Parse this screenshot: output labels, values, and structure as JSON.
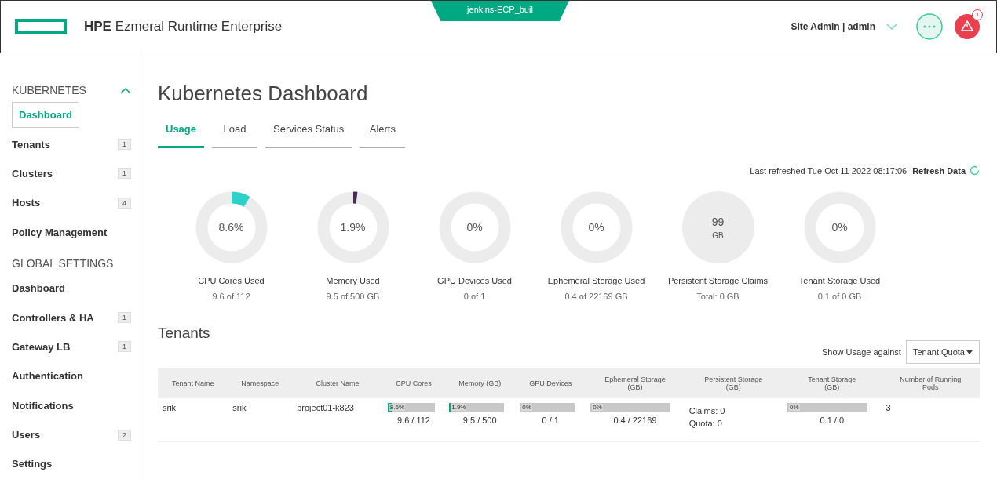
{
  "header": {
    "brand_bold": "HPE",
    "brand": "Ezmeral Runtime Enterprise",
    "context_tab": "jenkins-ECP_buil",
    "user": "Site Admin | admin",
    "alert_badge": "1"
  },
  "sidebar": {
    "items": [
      {
        "kind": "section",
        "label": "KUBERNETES",
        "expanded": true
      },
      {
        "kind": "item",
        "label": "Dashboard",
        "selected": true
      },
      {
        "kind": "item",
        "label": "Tenants",
        "count": "1",
        "selected": false
      },
      {
        "kind": "item",
        "label": "Clusters",
        "count": "1",
        "selected": false
      },
      {
        "kind": "item",
        "label": "Hosts",
        "count": "4",
        "selected": false
      },
      {
        "kind": "item",
        "label": "Policy Management",
        "selected": false
      },
      {
        "kind": "section",
        "label": "GLOBAL SETTINGS"
      },
      {
        "kind": "item",
        "label": "Dashboard",
        "selected": false
      },
      {
        "kind": "item",
        "label": "Controllers & HA",
        "count": "1",
        "selected": false
      },
      {
        "kind": "item",
        "label": "Gateway LB",
        "count": "1",
        "selected": false
      },
      {
        "kind": "item",
        "label": "Authentication",
        "selected": false
      },
      {
        "kind": "item",
        "label": "Notifications",
        "selected": false
      },
      {
        "kind": "item",
        "label": "Users",
        "count": "2",
        "selected": false
      },
      {
        "kind": "item",
        "label": "Settings",
        "selected": false
      }
    ]
  },
  "page": {
    "title": "Kubernetes Dashboard",
    "tabs": [
      {
        "label": "Usage",
        "selected": true
      },
      {
        "label": "Load",
        "selected": false
      },
      {
        "label": "Services Status",
        "selected": false
      },
      {
        "label": "Alerts",
        "selected": false
      }
    ],
    "last_refreshed": "Last refreshed Tue Oct 11 2022 08:17:06",
    "refresh_button": "Refresh Data",
    "gauges": [
      {
        "kind": "donut",
        "value": "8.6%",
        "level": 0.086,
        "color": "#2ad2c9",
        "label": "CPU Cores Used",
        "detail": "9.6 of 112"
      },
      {
        "kind": "donut",
        "value": "1.9%",
        "level": 0.019,
        "color": "#4b2a5a",
        "label": "Memory Used",
        "detail": "9.5 of 500 GB"
      },
      {
        "kind": "donut",
        "value": "0%",
        "label": "GPU Devices Used",
        "detail": "0 of 1"
      },
      {
        "kind": "donut",
        "value": "0%",
        "label": "Ephemeral Storage Used",
        "detail": "0.4 of 22169 GB"
      },
      {
        "kind": "filled",
        "value": "99",
        "unit": "GB",
        "label": "Persistent Storage Claims",
        "detail": "Total: 0 GB"
      },
      {
        "kind": "donut",
        "value": "0%",
        "label": "Tenant Storage Used",
        "detail": "0.1 of 0 GB"
      }
    ],
    "tenants": {
      "title": "Tenants",
      "usage_label": "Show Usage against",
      "usage_select": "Tenant Quota",
      "columns": [
        "Tenant Name",
        "Namespace",
        "Cluster Name",
        "CPU Cores",
        "Memory (GB)",
        "GPU Devices",
        "Ephemeral Storage (GB)",
        "Persistent Storage (GB)",
        "Tenant Storage (GB)",
        "Number of Running Pods"
      ],
      "rows": [
        {
          "cells": [
            {
              "kind": "text",
              "text": "srik"
            },
            {
              "kind": "text",
              "text": "srik"
            },
            {
              "kind": "text",
              "text": "project01-k823"
            },
            {
              "kind": "bar",
              "bar_label": "8.6%",
              "level": 0.086,
              "text": "9.6 / 112"
            },
            {
              "kind": "bar",
              "bar_label": "1.9%",
              "level": 0.019,
              "text": "9.5 / 500"
            },
            {
              "kind": "bar",
              "bar_label": "0%",
              "level": 0,
              "text": "0 / 1"
            },
            {
              "kind": "bar",
              "bar_label": "0%",
              "level": 0,
              "text": "0.4 / 22169"
            },
            {
              "kind": "lines",
              "lines": [
                "Claims: 0",
                "Quota: 0"
              ]
            },
            {
              "kind": "bar",
              "bar_label": "0%",
              "level": 0,
              "text": "0.1 / 0"
            },
            {
              "kind": "text",
              "text": "3"
            }
          ]
        }
      ]
    }
  }
}
